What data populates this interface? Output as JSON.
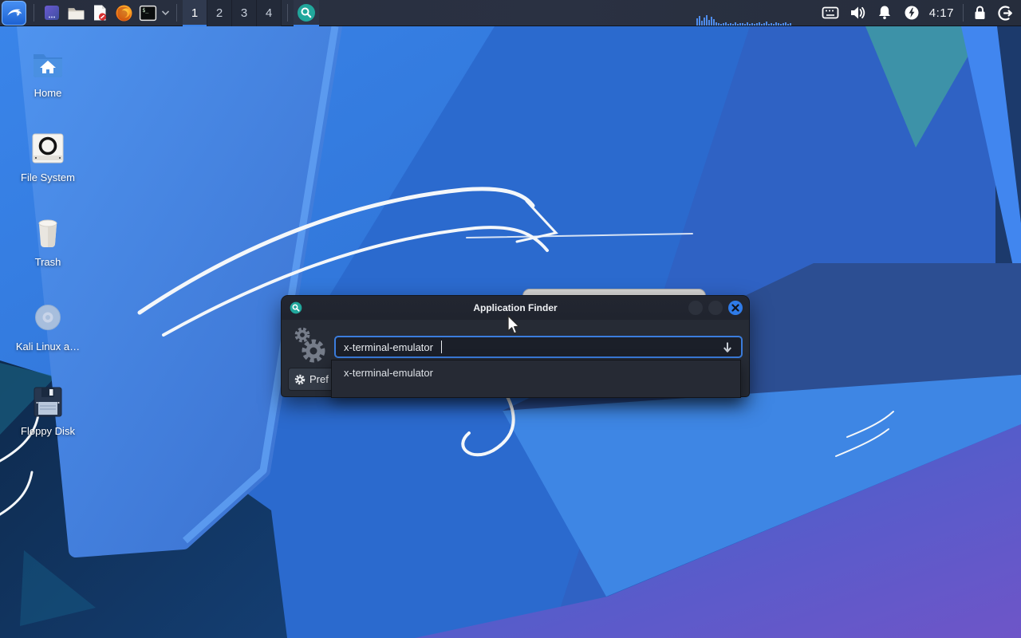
{
  "panel": {
    "workspaces": [
      "1",
      "2",
      "3",
      "4"
    ],
    "active_workspace": "1",
    "clock": "4:17",
    "terminal_glyph": "$_",
    "cpu_graph_bars": [
      9,
      12,
      6,
      10,
      13,
      7,
      11,
      8,
      4,
      3,
      2,
      3,
      4,
      2,
      3,
      2,
      4,
      2,
      3,
      3,
      2,
      4,
      2,
      3,
      2,
      3,
      4,
      2,
      3,
      5,
      2,
      3,
      2,
      4,
      3,
      2,
      3,
      4,
      2,
      3
    ]
  },
  "desktop": {
    "icons": [
      {
        "label": "Home"
      },
      {
        "label": "File System"
      },
      {
        "label": "Trash"
      },
      {
        "label": "Kali Linux a…"
      },
      {
        "label": "Floppy Disk"
      }
    ]
  },
  "finder": {
    "title": "Application Finder",
    "search_value": "x-terminal-emulator",
    "dropdown_items": [
      {
        "label": "x-terminal-emulator"
      }
    ],
    "preferences_label": "Pref"
  },
  "colors": {
    "accent": "#3c82e8",
    "panel_bg": "#2a3142",
    "search_teal": "#21a79c",
    "close_button": "#2f7be8"
  }
}
